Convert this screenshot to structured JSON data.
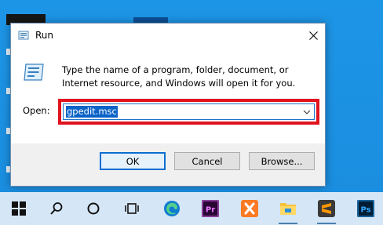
{
  "dialog": {
    "title": "Run",
    "description": "Type the name of a program, folder, document, or Internet resource, and Windows will open it for you.",
    "open_label": "Open:",
    "open_value": "gpedit.msc",
    "buttons": {
      "ok": "OK",
      "cancel": "Cancel",
      "browse": "Browse..."
    },
    "highlight_color": "#e0141f"
  },
  "taskbar": {
    "items": [
      {
        "icon": "windows-start-icon"
      },
      {
        "icon": "search-icon"
      },
      {
        "icon": "cortana-icon"
      },
      {
        "icon": "task-view-icon"
      },
      {
        "icon": "edge-icon"
      },
      {
        "icon": "premiere-pro-icon",
        "label": "Pr"
      },
      {
        "icon": "xampp-icon"
      },
      {
        "icon": "file-explorer-icon"
      },
      {
        "icon": "sublime-text-icon"
      },
      {
        "icon": "photoshop-icon",
        "label": "Ps"
      }
    ]
  }
}
